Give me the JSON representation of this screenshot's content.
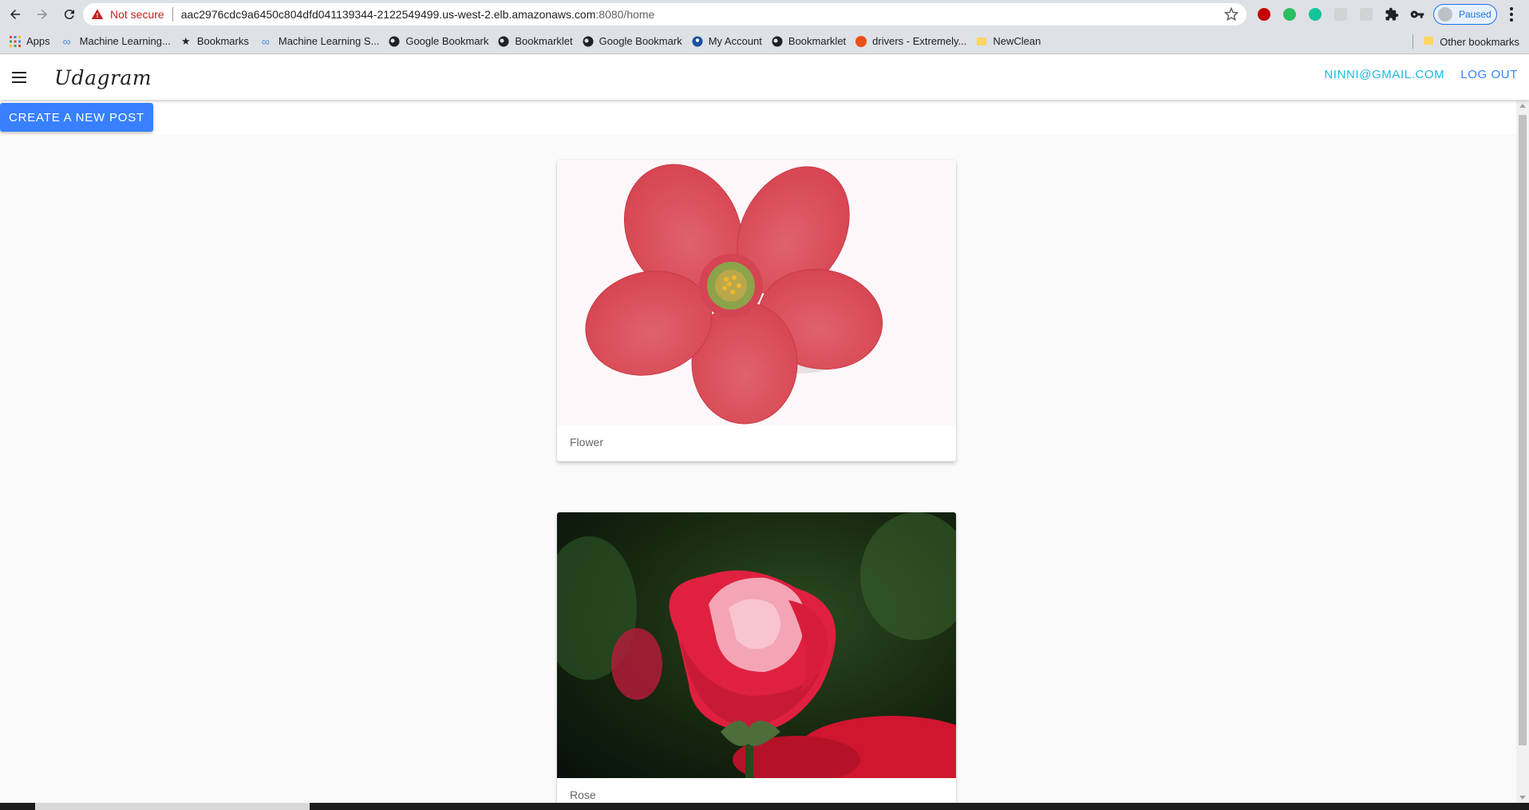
{
  "browser": {
    "address": {
      "security_label": "Not secure",
      "host": "aac2976cdc9a6450c804dfd041139344-2122549499.us-west-2.elb.amazonaws.com",
      "path": ":8080/home"
    },
    "profile_label": "Paused",
    "bookmarks": [
      {
        "label": "Apps",
        "icon": "apps-grid-icon"
      },
      {
        "label": "Machine Learning...",
        "icon": "infinity-icon"
      },
      {
        "label": "Bookmarks",
        "icon": "star-icon"
      },
      {
        "label": "Machine Learning S...",
        "icon": "infinity-icon"
      },
      {
        "label": "Google Bookmark",
        "icon": "globe-icon"
      },
      {
        "label": "Bookmarklet",
        "icon": "globe-icon"
      },
      {
        "label": "Google Bookmark",
        "icon": "globe-icon"
      },
      {
        "label": "My Account",
        "icon": "account-icon"
      },
      {
        "label": "Bookmarklet",
        "icon": "globe-icon"
      },
      {
        "label": "drivers - Extremely...",
        "icon": "ask-icon"
      },
      {
        "label": "NewClean",
        "icon": "folder-icon"
      }
    ],
    "other_bookmarks": "Other bookmarks"
  },
  "app": {
    "brand": "Udagram",
    "user_email": "NINNI@GMAIL.COM",
    "logout_label": "LOG OUT",
    "create_label": "CREATE A NEW POST",
    "colors": {
      "primary": "#3880ff",
      "secondary": "#1fb8e0"
    }
  },
  "posts": [
    {
      "caption": "Flower",
      "image": "pink-flower-image"
    },
    {
      "caption": "Rose",
      "image": "red-rose-image"
    }
  ]
}
